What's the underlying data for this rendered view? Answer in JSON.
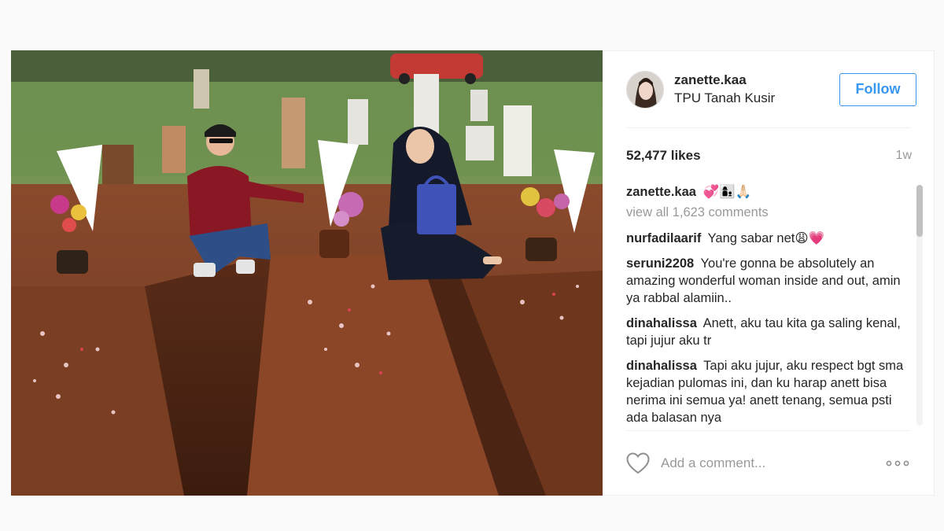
{
  "post": {
    "username": "zanette.kaa",
    "location": "TPU Tanah Kusir",
    "follow_label": "Follow",
    "likes": "52,477 likes",
    "time_ago": "1w",
    "caption": {
      "author": "zanette.kaa",
      "emoji": "💞👩‍👦🙏🏻"
    },
    "view_all_comments": "view all 1,623 comments",
    "comments": [
      {
        "author": "nurfadilaarif",
        "text": "Yang sabar net😩💗"
      },
      {
        "author": "seruni2208",
        "text": "You're gonna be absolutely an amazing wonderful woman inside and out, amin ya rabbal alamiin.."
      },
      {
        "author": "dinahalissa",
        "text": "Anett, aku tau kita ga saling kenal, tapi jujur aku tr"
      },
      {
        "author": "dinahalissa",
        "text": "Tapi aku jujur, aku respect bgt sma kejadian pulomas ini, dan ku harap anett bisa nerima ini semua ya! anett tenang, semua psti ada balasan nya"
      }
    ],
    "add_comment_placeholder": "Add a comment...",
    "colors": {
      "accent": "#3897f0",
      "muted": "#999999",
      "text": "#262626"
    },
    "icons": {
      "like": "heart-outline-icon",
      "more": "ellipsis-icon"
    }
  }
}
